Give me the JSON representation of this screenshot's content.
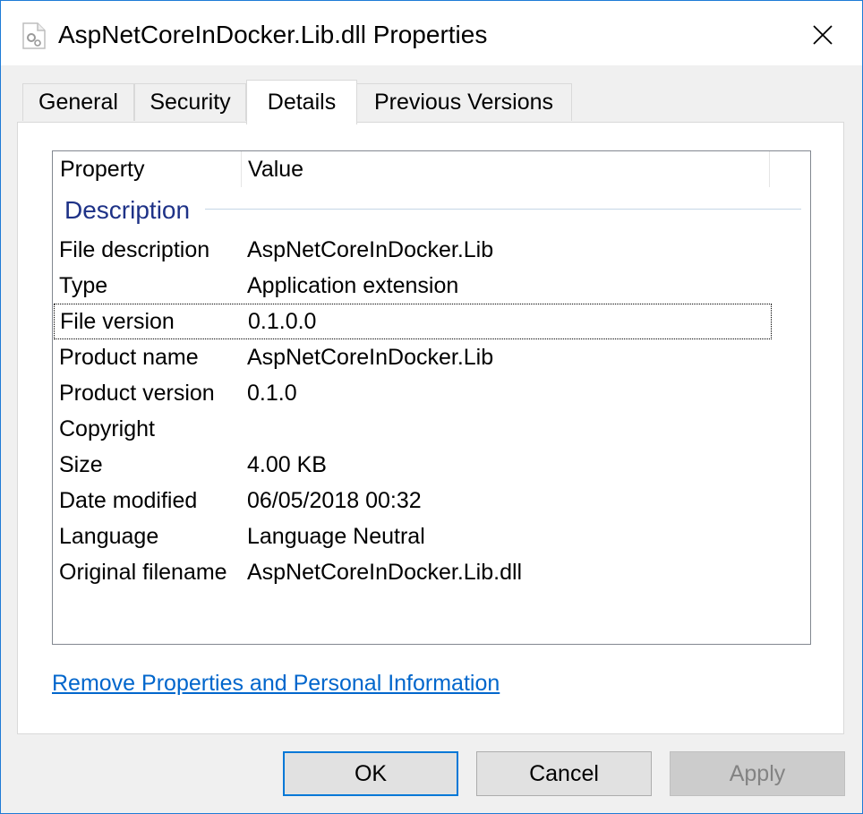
{
  "window": {
    "title": "AspNetCoreInDocker.Lib.dll Properties",
    "close_symbol": "✕"
  },
  "tabs": [
    {
      "label": "General",
      "active": false
    },
    {
      "label": "Security",
      "active": false
    },
    {
      "label": "Details",
      "active": true
    },
    {
      "label": "Previous Versions",
      "active": false
    }
  ],
  "details": {
    "columns": [
      "Property",
      "Value"
    ],
    "group": "Description",
    "rows": [
      {
        "property": "File description",
        "value": "AspNetCoreInDocker.Lib"
      },
      {
        "property": "Type",
        "value": "Application extension"
      },
      {
        "property": "File version",
        "value": "0.1.0.0"
      },
      {
        "property": "Product name",
        "value": "AspNetCoreInDocker.Lib"
      },
      {
        "property": "Product version",
        "value": "0.1.0"
      },
      {
        "property": "Copyright",
        "value": ""
      },
      {
        "property": "Size",
        "value": "4.00 KB"
      },
      {
        "property": "Date modified",
        "value": "06/05/2018 00:32"
      },
      {
        "property": "Language",
        "value": "Language Neutral"
      },
      {
        "property": "Original filename",
        "value": "AspNetCoreInDocker.Lib.dll"
      }
    ],
    "focused_row": "File version"
  },
  "link": "Remove Properties and Personal Information",
  "buttons": {
    "ok": "OK",
    "cancel": "Cancel",
    "apply": "Apply"
  },
  "colors": {
    "window_border": "#1e7bd6",
    "group_header": "#1e3287",
    "link": "#0066cc",
    "default_button_border": "#0078d7"
  }
}
